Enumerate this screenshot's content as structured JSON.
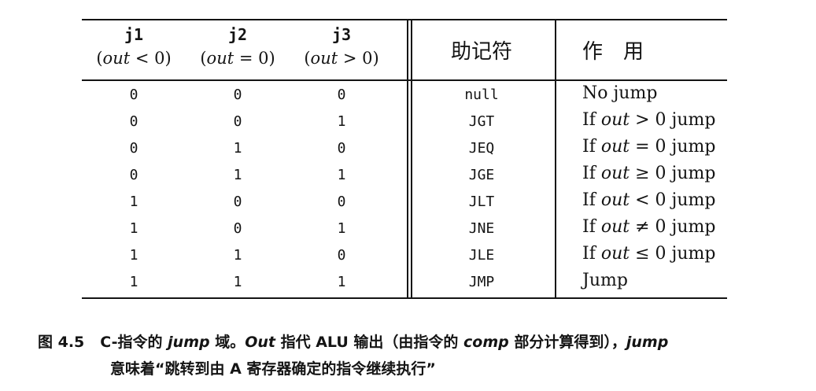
{
  "table": {
    "headers": {
      "j1": {
        "name": "j1",
        "condition_open": "(",
        "condition_var": "out",
        "condition_rest": " < 0)"
      },
      "j2": {
        "name": "j2",
        "condition_open": "(",
        "condition_var": "out",
        "condition_rest": " = 0)"
      },
      "j3": {
        "name": "j3",
        "condition_open": "(",
        "condition_var": "out",
        "condition_rest": " > 0)"
      },
      "mnemonic": "助记符",
      "effect": "作　用"
    },
    "rows": [
      {
        "j1": "0",
        "j2": "0",
        "j3": "0",
        "mnemonic": "null",
        "effect_pre": "No jump",
        "effect_var": "",
        "effect_post": ""
      },
      {
        "j1": "0",
        "j2": "0",
        "j3": "1",
        "mnemonic": "JGT",
        "effect_pre": "If ",
        "effect_var": "out",
        "effect_post": " > 0 jump"
      },
      {
        "j1": "0",
        "j2": "1",
        "j3": "0",
        "mnemonic": "JEQ",
        "effect_pre": "If ",
        "effect_var": "out",
        "effect_post": " = 0 jump"
      },
      {
        "j1": "0",
        "j2": "1",
        "j3": "1",
        "mnemonic": "JGE",
        "effect_pre": "If ",
        "effect_var": "out",
        "effect_post": " ≥ 0 jump"
      },
      {
        "j1": "1",
        "j2": "0",
        "j3": "0",
        "mnemonic": "JLT",
        "effect_pre": "If ",
        "effect_var": "out",
        "effect_post": " < 0 jump"
      },
      {
        "j1": "1",
        "j2": "0",
        "j3": "1",
        "mnemonic": "JNE",
        "effect_pre": "If ",
        "effect_var": "out",
        "effect_post": " ≠ 0 jump"
      },
      {
        "j1": "1",
        "j2": "1",
        "j3": "0",
        "mnemonic": "JLE",
        "effect_pre": "If ",
        "effect_var": "out",
        "effect_post": " ≤ 0 jump"
      },
      {
        "j1": "1",
        "j2": "1",
        "j3": "1",
        "mnemonic": "JMP",
        "effect_pre": "Jump",
        "effect_var": "",
        "effect_post": ""
      }
    ]
  },
  "caption": {
    "label": "图 4.5",
    "line1_a": "C-指令的 ",
    "line1_jump": "jump",
    "line1_b": " 域。",
    "line1_out": "Out",
    "line1_c": " 指代 ALU 输出（由指令的 ",
    "line1_comp": "comp",
    "line1_d": " 部分计算得到），",
    "line1_jump2": "jump",
    "line2": "意味着“跳转到由 A 寄存器确定的指令继续执行”"
  }
}
